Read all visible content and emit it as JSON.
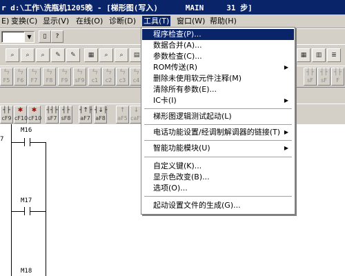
{
  "window": {
    "title": "r d:\\工作\\洗瓶机1205晚 - [梯形图(写入)      MAIN     31 步]"
  },
  "menubar": [
    {
      "label": "E)"
    },
    {
      "label": "变换(C)"
    },
    {
      "label": "显示(V)"
    },
    {
      "label": "在线(O)"
    },
    {
      "label": "诊断(D)"
    },
    {
      "label": "工具(T)"
    },
    {
      "label": "窗口(W)"
    },
    {
      "label": "帮助(H)"
    }
  ],
  "tools_menu": {
    "items": [
      {
        "label": "程序检查(P)...",
        "has_submenu": false
      },
      {
        "label": "数据合并(A)...",
        "has_submenu": false
      },
      {
        "label": "参数检查(C)...",
        "has_submenu": false
      },
      {
        "label": "ROM传送(R)",
        "has_submenu": true
      },
      {
        "label": "删除未使用软元件注释(M)",
        "has_submenu": false
      },
      {
        "label": "清除所有参数(E)...",
        "has_submenu": false
      },
      {
        "label": "IC卡(I)",
        "has_submenu": true
      },
      {
        "label": "梯形图逻辑测试起动(L)",
        "has_submenu": false
      },
      {
        "label": "电话功能设置/经调制解调器的链接(T)",
        "has_submenu": true
      },
      {
        "label": "智能功能模块(U)",
        "has_submenu": true
      },
      {
        "label": "自定义键(K)...",
        "has_submenu": false
      },
      {
        "label": "显示色改变(B)...",
        "has_submenu": false
      },
      {
        "label": "选项(O)...",
        "has_submenu": false
      },
      {
        "label": "起动设置文件的生成(G)...",
        "has_submenu": false
      }
    ]
  },
  "ladder_keys": [
    {
      "top": "ㄣ",
      "bottom": "F5"
    },
    {
      "top": "ㄣ",
      "bottom": "F6"
    },
    {
      "top": "ㄣ",
      "bottom": "F7"
    },
    {
      "top": "ㄣ",
      "bottom": "F8"
    },
    {
      "top": "ㄣ",
      "bottom": "F9"
    },
    {
      "top": "ㄣ",
      "bottom": "sF9"
    },
    {
      "top": "ㄣ",
      "bottom": "c1"
    },
    {
      "top": "ㄣ",
      "bottom": "c2"
    },
    {
      "top": "ㄣ",
      "bottom": "c3"
    },
    {
      "top": "ㄣ",
      "bottom": "c4"
    }
  ],
  "edit_keys": [
    {
      "top": "┤├",
      "bottom": "cF9"
    },
    {
      "top": "✱",
      "bottom": "cF10"
    },
    {
      "top": "✱",
      "bottom": "cF10"
    },
    {
      "top": "┤┤├",
      "bottom": "sF7"
    },
    {
      "top": "┤├",
      "bottom": "sF8"
    },
    {
      "top": "┤↑├",
      "bottom": "aF7"
    },
    {
      "top": "┤↓├",
      "bottom": "aF8"
    },
    {
      "top": "↑",
      "bottom": "aF5"
    },
    {
      "top": "↓",
      "bottom": "caF5"
    }
  ],
  "ladder": {
    "rows": [
      {
        "device": "M16",
        "row_number": "7"
      },
      {
        "device": "M17",
        "row_number": ""
      },
      {
        "device": "M18",
        "row_number": ""
      }
    ]
  },
  "colors": {
    "title_bg": "#0a246a",
    "menu_highlight": "#0a246a",
    "toolbar_bg": "#d4d0c8"
  }
}
